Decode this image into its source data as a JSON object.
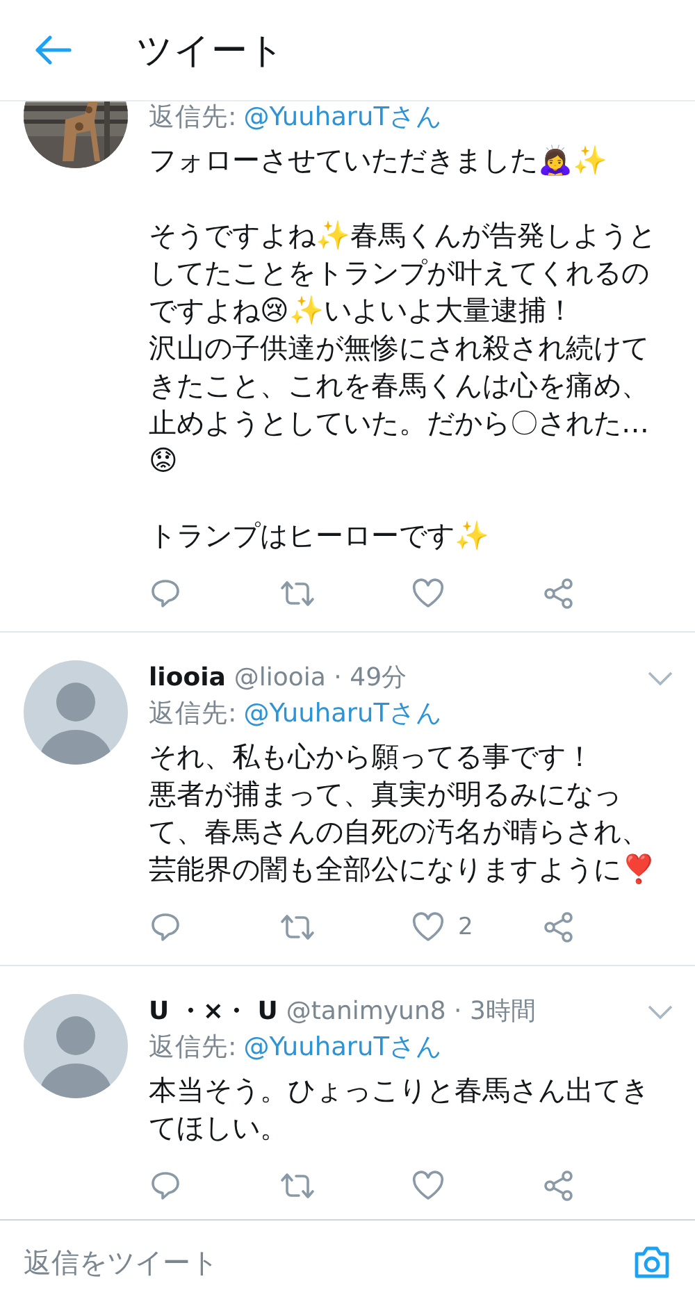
{
  "header": {
    "title": "ツイート"
  },
  "tweets": [
    {
      "avatar": {
        "kind": "picture"
      },
      "reply_label": "返信先:",
      "reply_to": "@YuuharuTさん",
      "paragraphs": [
        [
          "フォローさせていただきました🙇‍♀️✨"
        ],
        [
          "そうですよね✨春馬くんが告発しようとしてたことをトランプが叶えてくれるのですよね😢✨いよいよ大量逮捕！",
          "沢山の子供達が無惨にされ殺され続けてきたこと、これを春馬くんは心を痛め、止めようとしていた。だから〇された…",
          "😟"
        ],
        [
          "トランプはヒーローです✨"
        ]
      ]
    },
    {
      "avatar": {
        "kind": "silhouette"
      },
      "name": "liooia",
      "meta": "@liooia · 49分",
      "reply_label": "返信先:",
      "reply_to": "@YuuharuTさん",
      "paragraphs": [
        [
          "それ、私も心から願ってる事です！",
          "悪者が捕まって、真実が明るみになって、春馬さんの自死の汚名が晴らされ、芸能界の闇も全部公になりますように❣️"
        ]
      ],
      "like_count": "2"
    },
    {
      "avatar": {
        "kind": "silhouette"
      },
      "name": "U ・×・ U",
      "meta": "@tanimyun8 · 3時間",
      "reply_label": "返信先:",
      "reply_to": "@YuuharuTさん",
      "paragraphs": [
        [
          "本当そう。ひょっこりと春馬さん出てきてほしい。"
        ]
      ]
    }
  ],
  "reply_bar": {
    "placeholder": "返信をツイート"
  }
}
